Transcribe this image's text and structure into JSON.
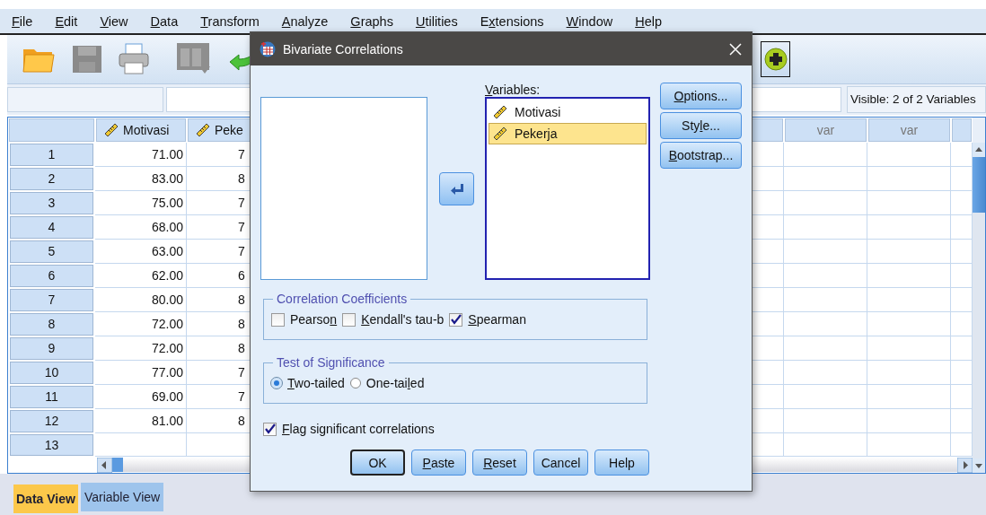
{
  "menu": [
    {
      "key": "F",
      "post": "ile"
    },
    {
      "key": "E",
      "post": "dit"
    },
    {
      "key": "V",
      "post": "iew"
    },
    {
      "key": "D",
      "post": "ata"
    },
    {
      "key": "T",
      "post": "ransform"
    },
    {
      "key": "A",
      "post": "nalyze"
    },
    {
      "key": "G",
      "post": "raphs"
    },
    {
      "key": "U",
      "post": "tilities"
    },
    {
      "pre": "E",
      "key": "x",
      "post": "tensions"
    },
    {
      "key": "W",
      "post": "indow"
    },
    {
      "key": "H",
      "post": "elp"
    }
  ],
  "status": "Visible: 2 of 2 Variables",
  "grid": {
    "columns": [
      {
        "label": "Motivasi",
        "kind": "scale"
      },
      {
        "label": "Peke",
        "kind": "scale"
      },
      {
        "label": "var",
        "kind": "new"
      },
      {
        "label": "var",
        "kind": "new"
      }
    ],
    "rows": [
      {
        "number": "1",
        "motivasi": "71.00",
        "pekerja": "7"
      },
      {
        "number": "2",
        "motivasi": "83.00",
        "pekerja": "8"
      },
      {
        "number": "3",
        "motivasi": "75.00",
        "pekerja": "7"
      },
      {
        "number": "4",
        "motivasi": "68.00",
        "pekerja": "7"
      },
      {
        "number": "5",
        "motivasi": "63.00",
        "pekerja": "7"
      },
      {
        "number": "6",
        "motivasi": "62.00",
        "pekerja": "6"
      },
      {
        "number": "7",
        "motivasi": "80.00",
        "pekerja": "8"
      },
      {
        "number": "8",
        "motivasi": "72.00",
        "pekerja": "8"
      },
      {
        "number": "9",
        "motivasi": "72.00",
        "pekerja": "8"
      },
      {
        "number": "10",
        "motivasi": "77.00",
        "pekerja": "7"
      },
      {
        "number": "11",
        "motivasi": "69.00",
        "pekerja": "7"
      },
      {
        "number": "12",
        "motivasi": "81.00",
        "pekerja": "8"
      },
      {
        "number": "13"
      }
    ]
  },
  "view_tabs": [
    {
      "label": "Data View",
      "selected": true
    },
    {
      "label": "Variable View",
      "selected": false
    }
  ],
  "dialog": {
    "title": "Bivariate Correlations",
    "variables_label": {
      "key": "V",
      "post": "ariables:"
    },
    "variables": [
      {
        "name": "Motivasi",
        "selected": false
      },
      {
        "name": "Pekerja",
        "selected": true
      }
    ],
    "side_buttons": [
      {
        "key": "O",
        "post": "ptions..."
      },
      {
        "pre": "Sty",
        "key": "l",
        "post": "e..."
      },
      {
        "key": "B",
        "post": "ootstrap..."
      }
    ],
    "coefficients": {
      "title": "Correlation Coefficients",
      "options": [
        {
          "label": {
            "pre": "Pearso",
            "key": "n"
          },
          "checked": false
        },
        {
          "label": {
            "key": "K",
            "post": "endall's tau-b"
          },
          "checked": false
        },
        {
          "label": {
            "key": "S",
            "post": "pearman"
          },
          "checked": true
        }
      ]
    },
    "significance": {
      "title": "Test of Significance",
      "options": [
        {
          "label": {
            "key": "T",
            "post": "wo-tailed"
          },
          "selected": true
        },
        {
          "label": {
            "pre": "One-tai",
            "key": "l",
            "post": "ed"
          },
          "selected": false
        }
      ]
    },
    "flag": {
      "label": {
        "key": "F",
        "post": "lag significant correlations"
      },
      "checked": true
    },
    "buttons": [
      {
        "label": {
          "pre": "OK"
        },
        "default": true
      },
      {
        "label": {
          "key": "P",
          "post": "aste"
        },
        "default": false
      },
      {
        "label": {
          "key": "R",
          "post": "eset"
        },
        "default": false
      },
      {
        "label": {
          "pre": "Cancel"
        },
        "default": false
      },
      {
        "label": {
          "pre": "Help"
        },
        "default": false
      }
    ]
  }
}
